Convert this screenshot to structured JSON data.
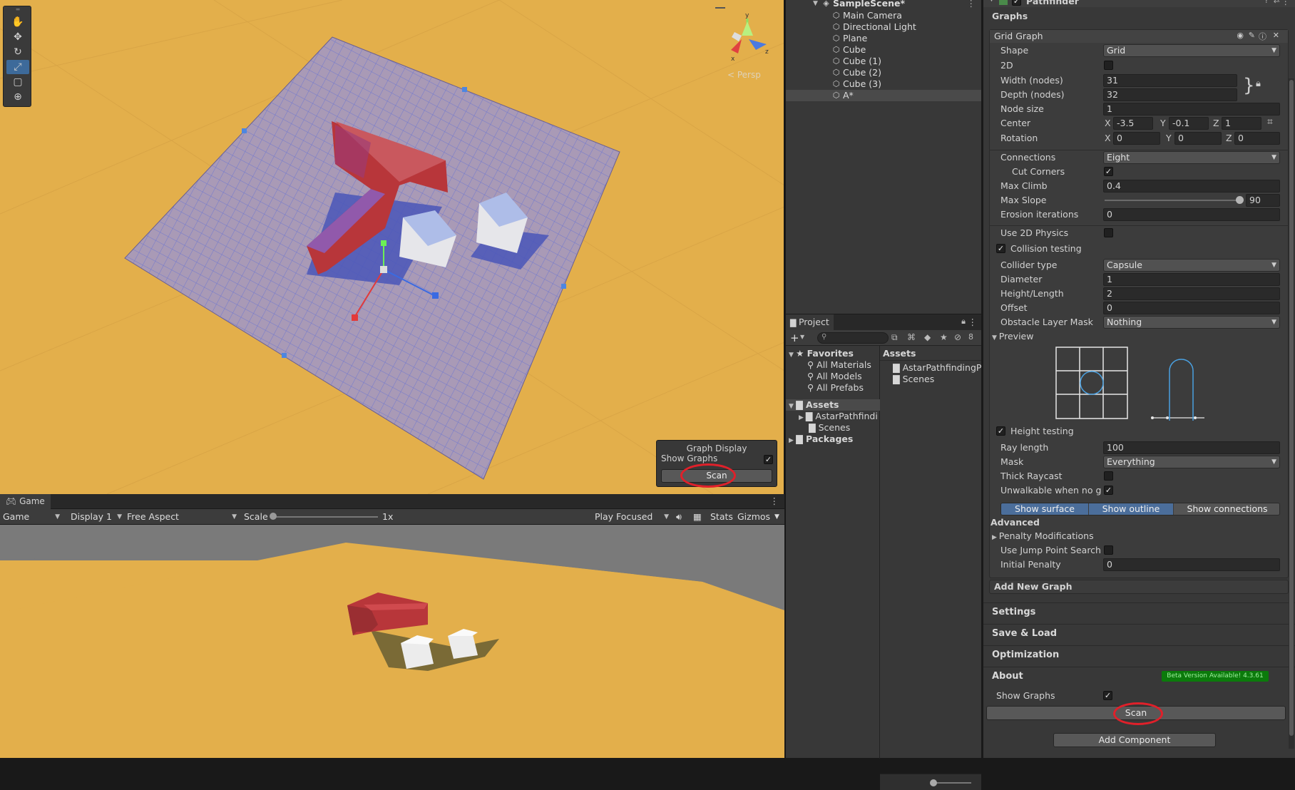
{
  "scene": {
    "tools": [
      "hand-tool",
      "move-tool",
      "rotate-tool",
      "scale-tool",
      "rect-tool",
      "transform-tool"
    ],
    "active_tool": 3,
    "gizmo_label": "< Persp",
    "gizmo_axes": {
      "y": "y",
      "z": "z",
      "x": "x"
    },
    "overlay": {
      "title": "Graph Display",
      "show_graphs_label": "Show Graphs",
      "show_graphs_checked": true,
      "scan_label": "Scan"
    }
  },
  "game": {
    "tab_label": "Game",
    "mode": "Game",
    "display": "Display 1",
    "aspect": "Free Aspect",
    "scale_label": "Scale",
    "scale_value": "1x",
    "play_mode": "Play Focused",
    "stats": "Stats",
    "gizmos": "Gizmos"
  },
  "hierarchy": {
    "scene_name": "SampleScene*",
    "items": [
      "Main Camera",
      "Directional Light",
      "Plane",
      "Cube",
      "Cube (1)",
      "Cube (2)",
      "Cube (3)",
      "A*"
    ],
    "selected_index": 7
  },
  "project": {
    "tab_label": "Project",
    "hidden_count": "8",
    "favorites_label": "Favorites",
    "favorites": [
      "All Materials",
      "All Models",
      "All Prefabs"
    ],
    "assets_label": "Assets",
    "assets_tree": [
      "AstarPathfindi",
      "Scenes"
    ],
    "packages_label": "Packages",
    "breadcrumb": "Assets",
    "assets_items": [
      "AstarPathfindingPro",
      "Scenes"
    ]
  },
  "inspector": {
    "component_name": "Pathfinder",
    "graphs_header": "Graphs",
    "graph_title": "Grid Graph",
    "shape": {
      "label": "Shape",
      "value": "Grid"
    },
    "two_d": {
      "label": "2D",
      "checked": false
    },
    "width": {
      "label": "Width (nodes)",
      "value": "31"
    },
    "depth": {
      "label": "Depth (nodes)",
      "value": "32"
    },
    "node_size": {
      "label": "Node size",
      "value": "1"
    },
    "center": {
      "label": "Center",
      "x": "-3.5",
      "y": "-0.1",
      "z": "1"
    },
    "rotation": {
      "label": "Rotation",
      "x": "0",
      "y": "0",
      "z": "0"
    },
    "axis_labels": {
      "x": "X",
      "y": "Y",
      "z": "Z"
    },
    "connections": {
      "label": "Connections",
      "value": "Eight"
    },
    "cut_corners": {
      "label": "Cut Corners",
      "checked": true
    },
    "max_climb": {
      "label": "Max Climb",
      "value": "0.4"
    },
    "max_slope": {
      "label": "Max Slope",
      "value": "90",
      "fraction": 1.0
    },
    "erosion": {
      "label": "Erosion iterations",
      "value": "0"
    },
    "use_2d_physics": {
      "label": "Use 2D Physics",
      "checked": false
    },
    "collision_testing": {
      "label": "Collision testing",
      "checked": true
    },
    "collider_type": {
      "label": "Collider type",
      "value": "Capsule"
    },
    "diameter": {
      "label": "Diameter",
      "value": "1"
    },
    "height_length": {
      "label": "Height/Length",
      "value": "2"
    },
    "offset": {
      "label": "Offset",
      "value": "0"
    },
    "obstacle_mask": {
      "label": "Obstacle Layer Mask",
      "value": "Nothing"
    },
    "preview_label": "Preview",
    "height_testing": {
      "label": "Height testing",
      "checked": true
    },
    "ray_length": {
      "label": "Ray length",
      "value": "100"
    },
    "mask": {
      "label": "Mask",
      "value": "Everything"
    },
    "thick_raycast": {
      "label": "Thick Raycast",
      "checked": false
    },
    "unwalkable": {
      "label": "Unwalkable when no grou",
      "checked": true
    },
    "toggles": [
      "Show surface",
      "Show outline",
      "Show connections"
    ],
    "advanced_label": "Advanced",
    "penalty_label": "Penalty Modifications",
    "jump_point": {
      "label": "Use Jump Point Search",
      "checked": false
    },
    "initial_penalty": {
      "label": "Initial Penalty",
      "value": "0"
    },
    "add_new_graph": "Add New Graph",
    "sections": [
      "Settings",
      "Save & Load",
      "Optimization",
      "About"
    ],
    "beta_badge": "Beta Version Available! 4.3.61",
    "show_graphs": {
      "label": "Show Graphs",
      "checked": true
    },
    "scan_label": "Scan",
    "add_component": "Add Component"
  },
  "colors": {
    "ground": "#e3af4b",
    "grid_plane": "#a99ab6",
    "wall_red": "#b8363a",
    "panel_bg": "#383838",
    "toggle_active": "#4b6e9b",
    "badge_green": "#0b7a0b",
    "highlight_red": "#e0202a"
  }
}
